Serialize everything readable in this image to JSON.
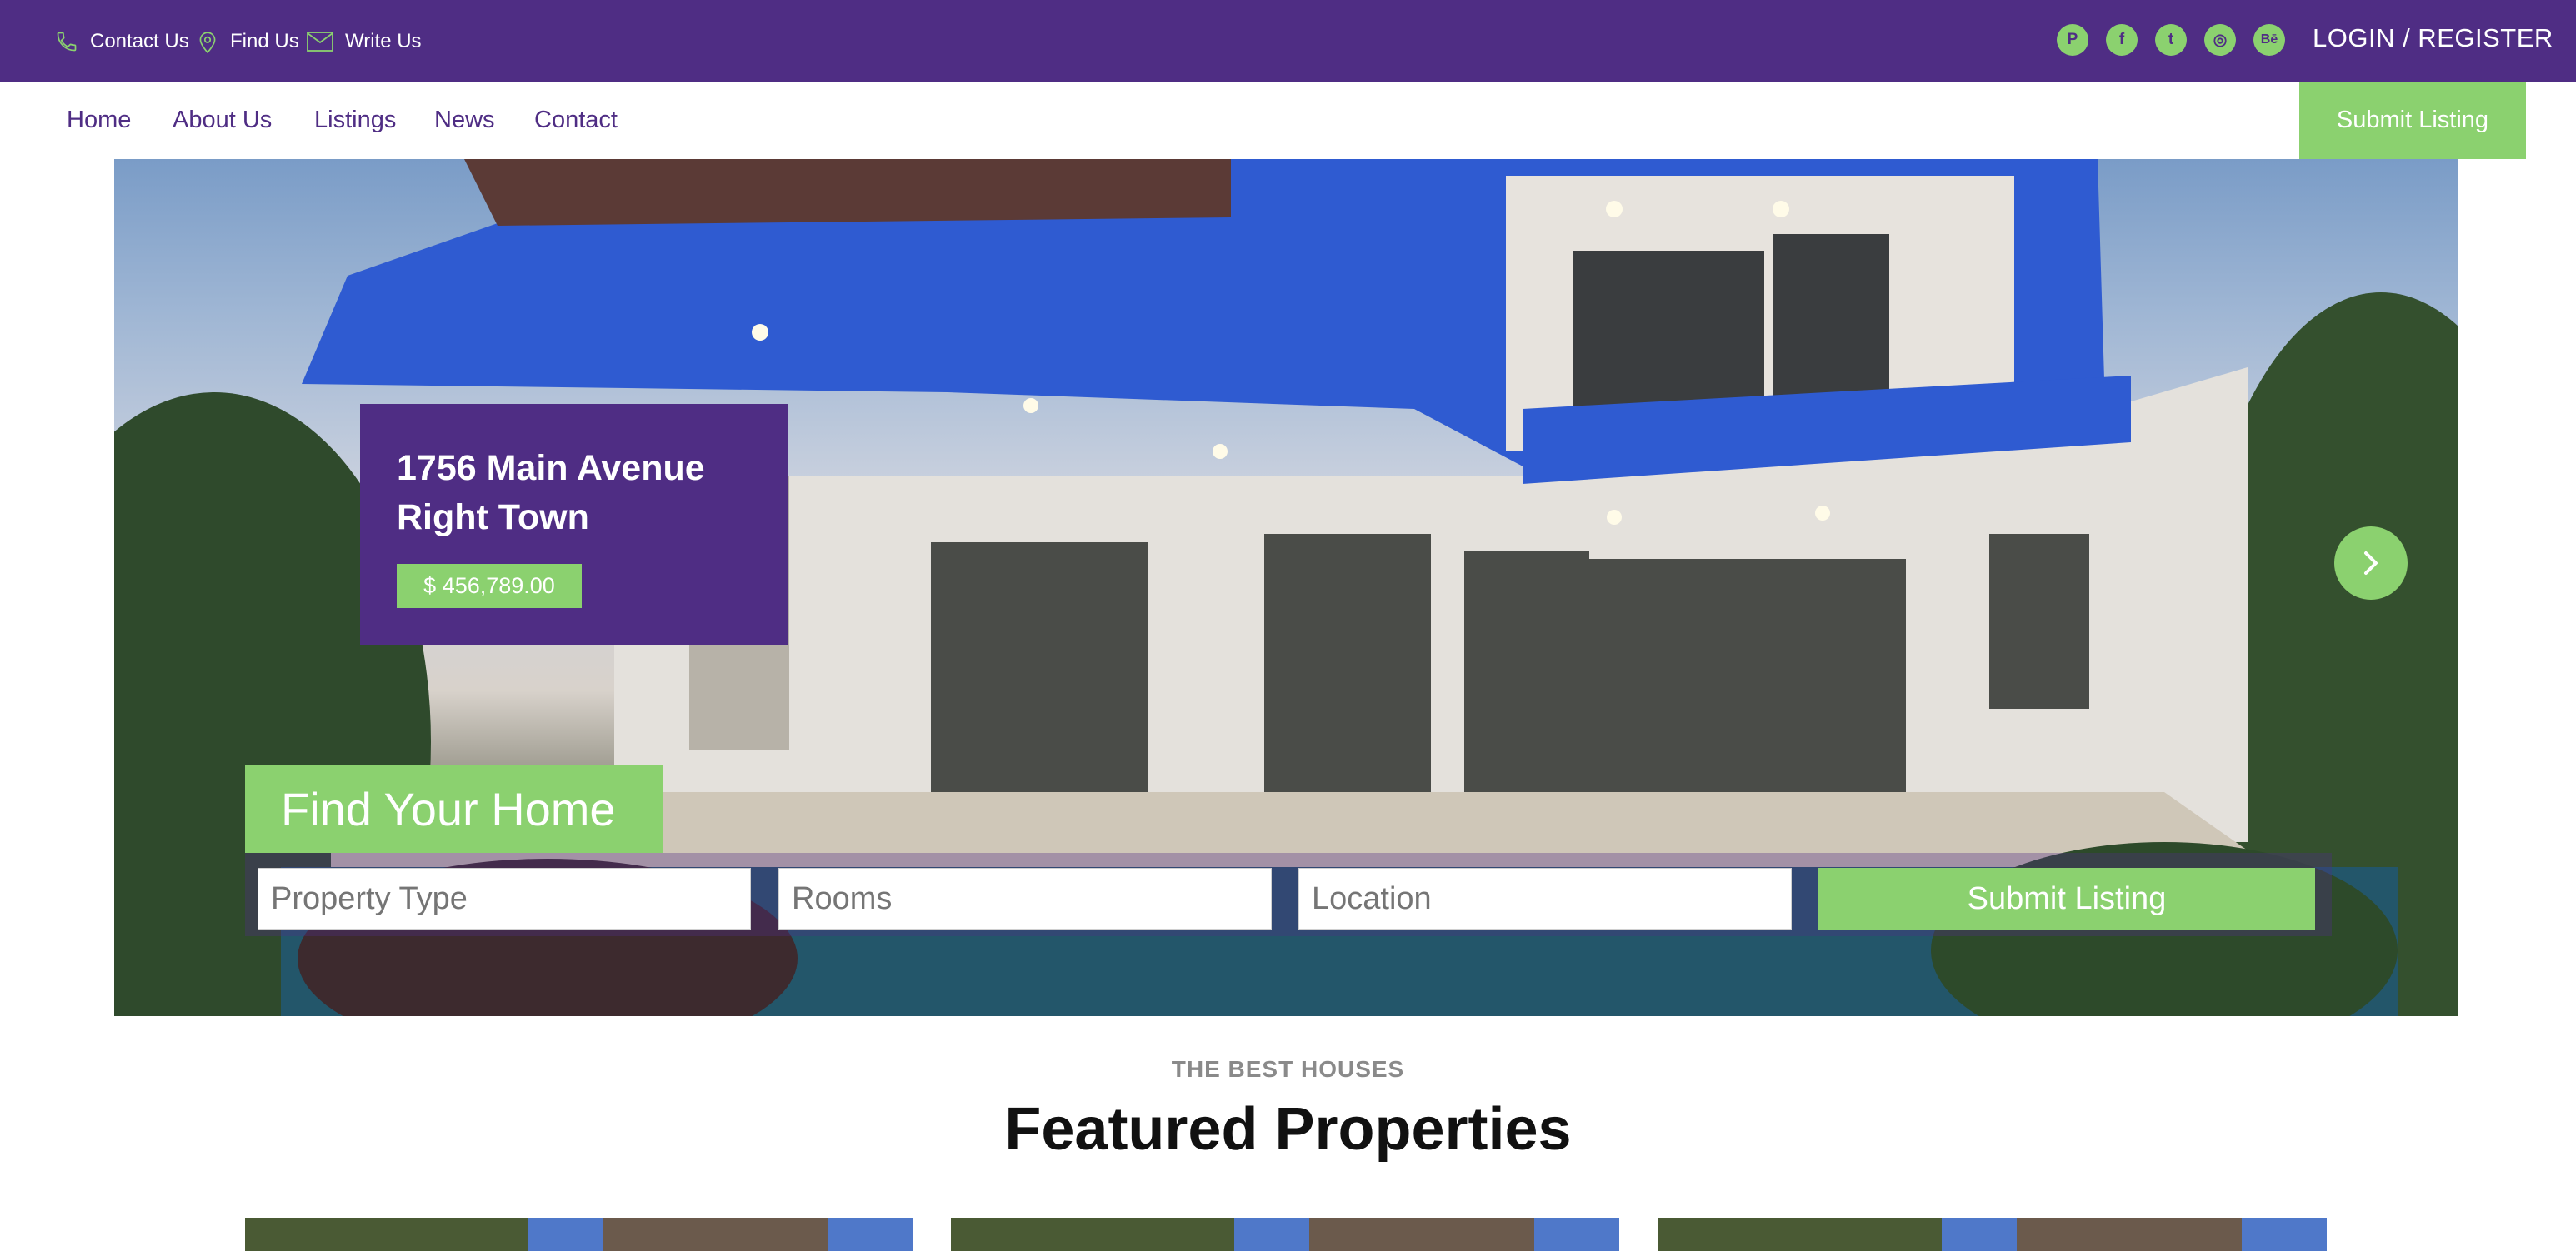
{
  "topbar": {
    "contacts": [
      {
        "label": "Contact Us",
        "icon": "phone-icon"
      },
      {
        "label": "Find Us",
        "icon": "map-pin-icon"
      },
      {
        "label": "Write Us",
        "icon": "envelope-icon"
      }
    ],
    "socials": [
      {
        "name": "pinterest-icon",
        "glyph": "P"
      },
      {
        "name": "facebook-icon",
        "glyph": "f"
      },
      {
        "name": "twitter-icon",
        "glyph": "t"
      },
      {
        "name": "dribbble-icon",
        "glyph": "◎"
      },
      {
        "name": "behance-icon",
        "glyph": "Bē"
      }
    ],
    "login_label": "LOGIN / REGISTER"
  },
  "nav": {
    "items": [
      "Home",
      "About Us",
      "Listings",
      "News",
      "Contact"
    ],
    "submit_label": "Submit Listing"
  },
  "hero": {
    "address_line1": "1756 Main Avenue",
    "address_line2": "Right Town",
    "price": "$ 456,789.00"
  },
  "search": {
    "title": "Find Your Home",
    "property_type_placeholder": "Property Type",
    "rooms_placeholder": "Rooms",
    "location_placeholder": "Location",
    "submit_label": "Submit Listing"
  },
  "featured": {
    "eyebrow": "THE BEST HOUSES",
    "title": "Featured Properties"
  },
  "colors": {
    "brand_purple": "#4f2d84",
    "accent_green": "#8bd16f"
  }
}
